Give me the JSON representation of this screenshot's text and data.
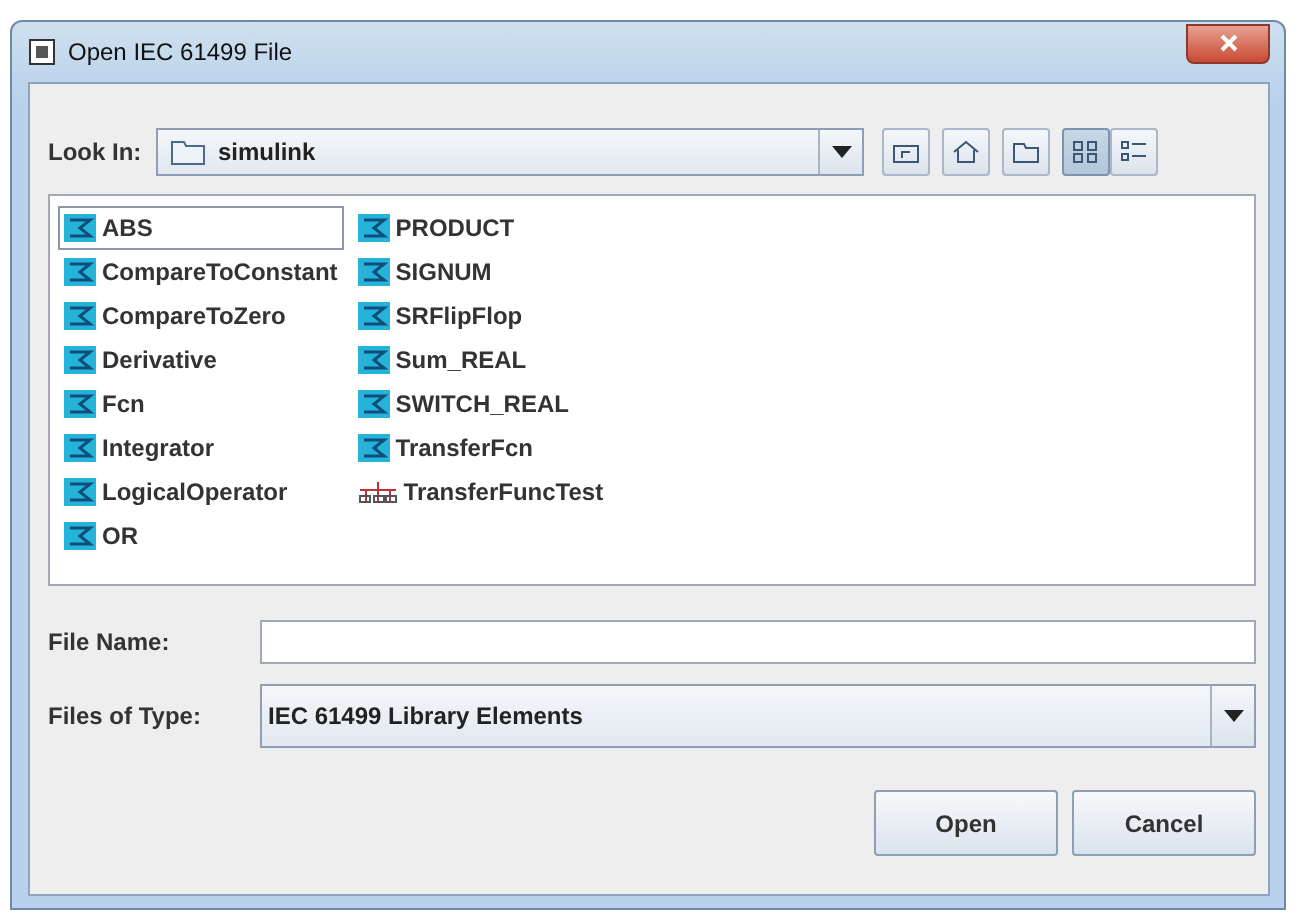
{
  "window": {
    "title": "Open IEC 61499 File"
  },
  "look_in": {
    "label": "Look In:",
    "value": "simulink"
  },
  "toolbar": [
    {
      "kind": "up",
      "selected": false
    },
    {
      "kind": "home",
      "selected": false
    },
    {
      "kind": "newfolder",
      "selected": false
    },
    {
      "kind": "list",
      "selected": true
    },
    {
      "kind": "details",
      "selected": false
    }
  ],
  "files": {
    "columns": [
      [
        {
          "name": "ABS",
          "kind": "block",
          "selected": true
        },
        {
          "name": "CompareToConstant",
          "kind": "block",
          "selected": false
        },
        {
          "name": "CompareToZero",
          "kind": "block",
          "selected": false
        },
        {
          "name": "Derivative",
          "kind": "block",
          "selected": false
        },
        {
          "name": "Fcn",
          "kind": "block",
          "selected": false
        },
        {
          "name": "Integrator",
          "kind": "block",
          "selected": false
        },
        {
          "name": "LogicalOperator",
          "kind": "block",
          "selected": false
        },
        {
          "name": "OR",
          "kind": "block",
          "selected": false
        }
      ],
      [
        {
          "name": "PRODUCT",
          "kind": "block",
          "selected": false
        },
        {
          "name": "SIGNUM",
          "kind": "block",
          "selected": false
        },
        {
          "name": "SRFlipFlop",
          "kind": "block",
          "selected": false
        },
        {
          "name": "Sum_REAL",
          "kind": "block",
          "selected": false
        },
        {
          "name": "SWITCH_REAL",
          "kind": "block",
          "selected": false
        },
        {
          "name": "TransferFcn",
          "kind": "block",
          "selected": false
        },
        {
          "name": "TransferFuncTest",
          "kind": "network",
          "selected": false
        }
      ]
    ]
  },
  "file_name": {
    "label": "File Name:"
  },
  "file_type": {
    "label": "Files of Type:",
    "value": "IEC 61499 Library Elements"
  },
  "buttons": [
    "Open",
    "Cancel"
  ]
}
